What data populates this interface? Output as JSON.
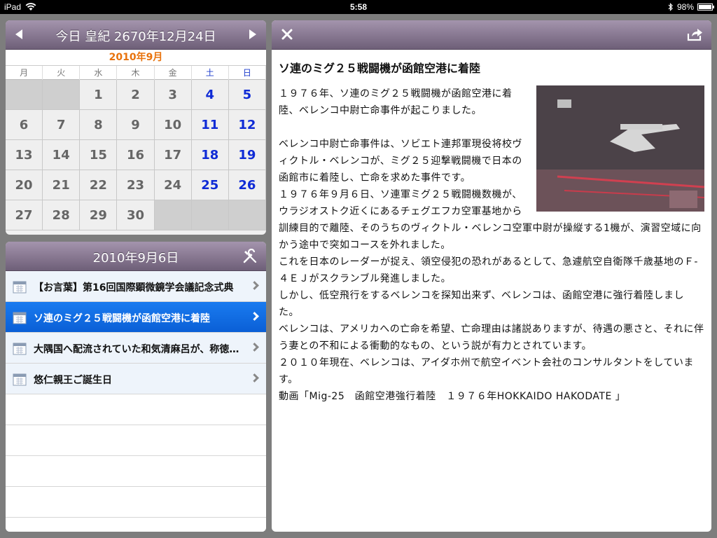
{
  "status": {
    "device": "iPad",
    "time": "5:58",
    "battery": "98%",
    "battery_level": 0.98
  },
  "calendar": {
    "header": "今日 皇紀 2670年12月24日",
    "month": "2010年9月",
    "weekdays": [
      "月",
      "火",
      "水",
      "木",
      "金",
      "土",
      "日"
    ],
    "weeks": [
      [
        "",
        "",
        "1",
        "2",
        "3",
        "4",
        "5"
      ],
      [
        "6",
        "7",
        "8",
        "9",
        "10",
        "11",
        "12"
      ],
      [
        "13",
        "14",
        "15",
        "16",
        "17",
        "18",
        "19"
      ],
      [
        "20",
        "21",
        "22",
        "23",
        "24",
        "25",
        "26"
      ],
      [
        "27",
        "28",
        "29",
        "30",
        "",
        "",
        ""
      ]
    ]
  },
  "events": {
    "date": "2010年9月6日",
    "items": [
      "【お言葉】第16回国際顕微鏡学会議記念式典",
      "ソ連のミグ２５戦闘機が函館空港に着陸",
      "大隅国へ配流されていた和気清麻呂が、称徳天皇の崩御により許され",
      "悠仁親王ご誕生日"
    ],
    "selected_index": 1
  },
  "detail": {
    "title": "ソ連のミグ２５戦闘機が函館空港に着陸",
    "intro": "１９７６年、ソ連のミグ２５戦闘機が函館空港に着陸、ベレンコ中尉亡命事件が起こりました。",
    "paragraphs": [
      "ベレンコ中尉亡命事件は、ソビエト連邦軍現役将校ヴィクトル・ベレンコが、ミグ２５迎撃戦闘機で日本の函館市に着陸し、亡命を求めた事件です。",
      "１９７６年９月６日、ソ連軍ミグ２５戦闘機数機が、ウラジオストク近くにあるチェグエフカ空軍基地から訓練目的で離陸、そのうちのヴィクトル・ベレンコ空軍中尉が操縦する1機が、演習空域に向かう途中で突如コースを外れました。",
      "これを日本のレーダーが捉え、領空侵犯の恐れがあるとして、急遽航空自衛隊千歳基地のＦ-４ＥＪがスクランブル発進しました。",
      "しかし、低空飛行をするベレンコを探知出来ず、ベレンコは、函館空港に強行着陸しました。",
      "ベレンコは、アメリカへの亡命を希望、亡命理由は諸説ありますが、待遇の悪さと、それに伴う妻との不和による衝動的なもの、という説が有力とされています。",
      "２０１０年現在、ベレンコは、アイダホ州で航空イベント会社のコンサルタントをしています。"
    ],
    "video": "動画「Mig-25　函館空港強行着陸　１９７６年HOKKAIDO HAKODATE 」"
  }
}
